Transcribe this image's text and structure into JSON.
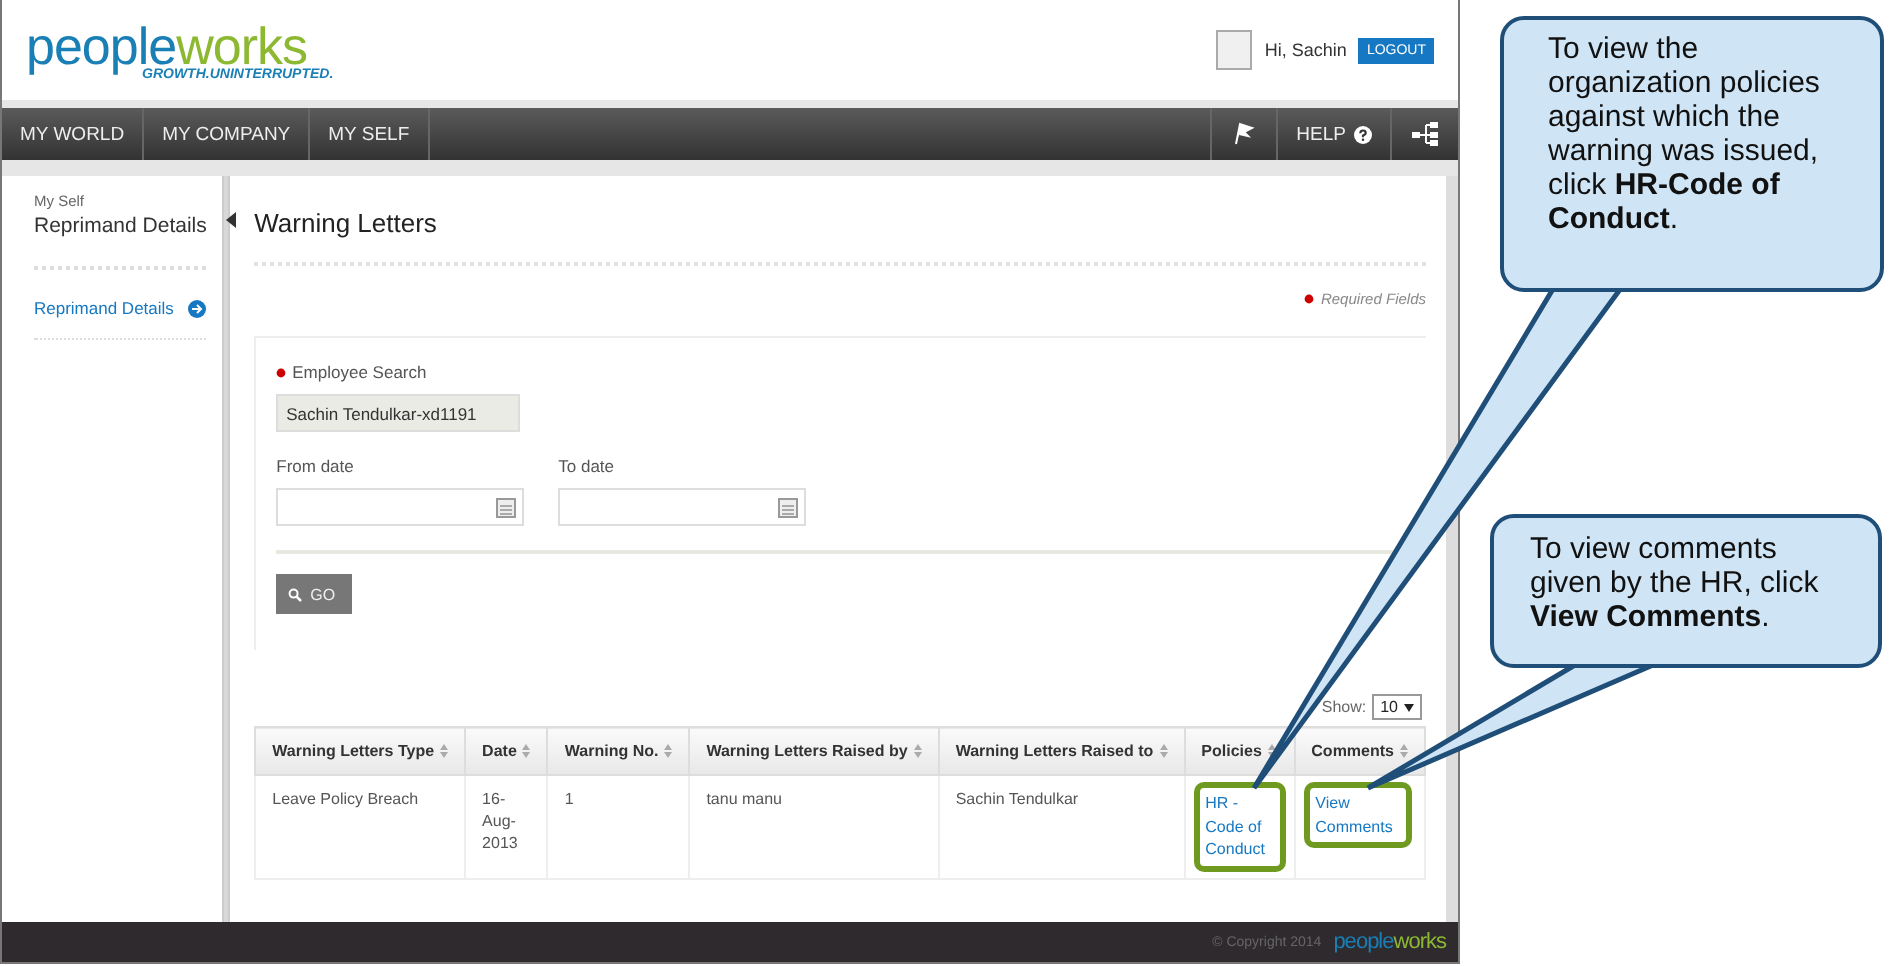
{
  "header": {
    "logo": [
      "pe",
      "o",
      "ple",
      "w",
      "o",
      "rks"
    ],
    "tagline": "GROWTH.UNINTERRUPTED.",
    "greeting": "Hi, Sachin",
    "logout": "LOGOUT"
  },
  "nav": {
    "items": [
      {
        "label": "MY WORLD",
        "selected": false
      },
      {
        "label": "MY COMPANY",
        "selected": false
      },
      {
        "label": "MY SELF",
        "selected": false
      }
    ],
    "help": "HELP"
  },
  "sidebar": {
    "section": "My Self",
    "title": "Reprimand Details",
    "items": [
      {
        "label": "Reprimand Details",
        "selected": true
      }
    ]
  },
  "page": {
    "title": "Warning Letters",
    "required_note": "Required Fields"
  },
  "form": {
    "employee_search": {
      "label": "Employee Search",
      "value": "Sachin Tendulkar-xd1191",
      "required": true
    },
    "from_date": {
      "label": "From date"
    },
    "to_date": {
      "label": "To date"
    },
    "go": "GO"
  },
  "table": {
    "show_label": "Show:",
    "page_size": "10",
    "columns": [
      "Warning Letters Type",
      "Date",
      "Warning No.",
      "Warning Letters Raised by",
      "Warning Letters Raised to",
      "Policies",
      "Comments"
    ],
    "rows": [
      {
        "cells": [
          "Leave Policy Breach",
          "16-Aug-2013",
          "1",
          "tanu manu",
          "Sachin Tendulkar"
        ],
        "policy_link": {
          "text": "HR - Code of Conduct",
          "highlighted": true
        },
        "comments_link": {
          "text": "View Comments",
          "highlighted": true
        }
      }
    ]
  },
  "footer": {
    "copyright": "© Copyright 2014",
    "logo": [
      "pe",
      "o",
      "ple",
      "w",
      "o",
      "rks"
    ]
  },
  "callouts": [
    {
      "text": "To view the organization policies against which the warning was issued, click **HR-Code of Conduct**."
    },
    {
      "text": "To view comments given by the HR, click **View Comments**."
    }
  ]
}
